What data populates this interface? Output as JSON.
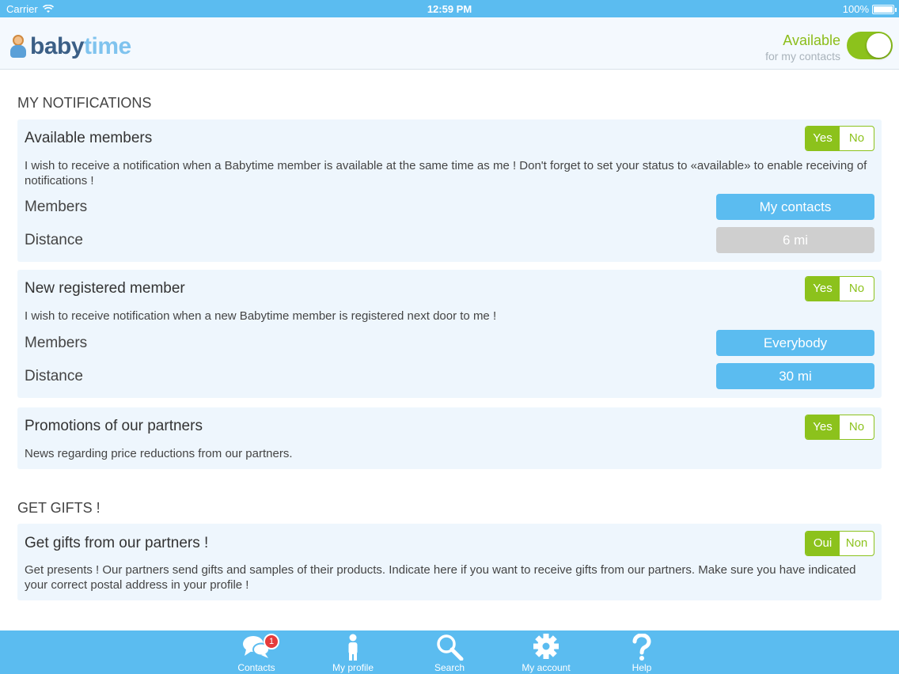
{
  "status_bar": {
    "carrier": "Carrier",
    "time": "12:59 PM",
    "battery": "100%"
  },
  "header": {
    "logo_part1": "baby",
    "logo_part2": "time",
    "availability_title": "Available",
    "availability_subtitle": "for my contacts",
    "availability_on": true
  },
  "notifications": {
    "section_title": "MY NOTIFICATIONS",
    "available_members": {
      "title": "Available members",
      "yes": "Yes",
      "no": "No",
      "description": "I wish to receive a notification when a Babytime member is available at the same time as me ! Don't forget to set your status to «available» to enable receiving of notifications !",
      "members_label": "Members",
      "members_value": "My contacts",
      "distance_label": "Distance",
      "distance_value": "6 mi"
    },
    "new_member": {
      "title": "New registered member",
      "yes": "Yes",
      "no": "No",
      "description": "I wish to receive notification when a new Babytime member is registered next door to me !",
      "members_label": "Members",
      "members_value": "Everybody",
      "distance_label": "Distance",
      "distance_value": "30 mi"
    },
    "promotions": {
      "title": "Promotions of our partners",
      "yes": "Yes",
      "no": "No",
      "description": "News regarding price reductions from our partners."
    }
  },
  "gifts": {
    "section_title": "GET GIFTS !",
    "title": "Get gifts from our partners !",
    "yes": "Oui",
    "no": "Non",
    "description": "Get presents ! Our partners send gifts and samples of their products. Indicate here if you want to receive gifts from our partners. Make sure you have indicated your correct postal address in your profile !"
  },
  "tabbar": {
    "contacts": "Contacts",
    "contacts_badge": "1",
    "profile": "My profile",
    "search": "Search",
    "account": "My account",
    "help": "Help"
  },
  "colors": {
    "accent_blue": "#5bbcf0",
    "accent_green": "#8cc21c",
    "card_bg": "#eef6fd"
  }
}
